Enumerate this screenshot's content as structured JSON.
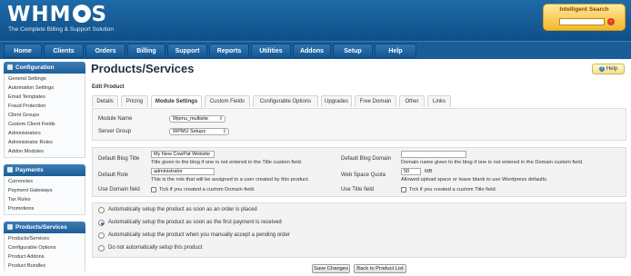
{
  "header": {
    "logo_text": "WHMCS",
    "tagline": "The Complete Billing & Support Solution",
    "search_title": "Intelligent Search",
    "search_go_icon": "go-icon"
  },
  "nav": [
    "Home",
    "Clients",
    "Orders",
    "Billing",
    "Support",
    "Reports",
    "Utilities",
    "Addons",
    "Setup",
    "Help"
  ],
  "sidebar": {
    "configuration": {
      "title": "Configuration",
      "items": [
        "General Settings",
        "Automation Settings",
        "Email Templates",
        "Fraud Protection",
        "Client Groups",
        "Custom Client Fields",
        "Administrators",
        "Administrator Roles",
        "Addon Modules"
      ]
    },
    "payments": {
      "title": "Payments",
      "items": [
        "Currencies",
        "Payment Gateways",
        "Tax Rules",
        "Promotions"
      ]
    },
    "products": {
      "title": "Products/Services",
      "items": [
        "Products/Services",
        "Configurable Options",
        "Product Addons",
        "Product Bundles"
      ]
    }
  },
  "main": {
    "title": "Products/Services",
    "help_label": "Help",
    "section": "Edit Product",
    "tabs": [
      "Details",
      "Pricing",
      "Module Settings",
      "Custom Fields",
      "Configurable Options",
      "Upgrades",
      "Free Domain",
      "Other",
      "Links"
    ],
    "active_tab": "Module Settings",
    "module": {
      "module_name_label": "Module Name",
      "module_name_value": "Wpmu_multisite",
      "server_group_label": "Server Group",
      "server_group_value": "WPMU Setups"
    },
    "fields": {
      "blog_title_label": "Default Blog Title",
      "blog_title_value": "My New CowPat Website",
      "blog_title_desc": "Title given to the blog if one is not entered in the Title custom field.",
      "blog_domain_label": "Default Blog Domain",
      "blog_domain_value": "",
      "blog_domain_desc": "Domain name given to the blog if one is not entered in the Domain custom field.",
      "role_label": "Default Role",
      "role_value": "administrator",
      "role_desc": "This is the role that will be assigned to a user created by this product.",
      "quota_label": "Web Space Quota",
      "quota_value": "50",
      "quota_unit": "MB",
      "quota_desc": "Allowed upload space or leave blank to use Wordpress defaults.",
      "use_domain_label": "Use Domain field",
      "use_domain_desc": "Tick if you created a custom Domain field.",
      "use_title_label": "Use Title field",
      "use_title_desc": "Tick if you created a custom Title field."
    },
    "setup_options": [
      "Automatically setup the product as soon as an order is placed",
      "Automatically setup the product as soon as the first payment is received",
      "Automatically setup the product when you manually accept a pending order",
      "Do not automatically setup this product"
    ],
    "selected_setup_option": 1,
    "save_label": "Save Changes",
    "back_label": "Back to Product List"
  }
}
